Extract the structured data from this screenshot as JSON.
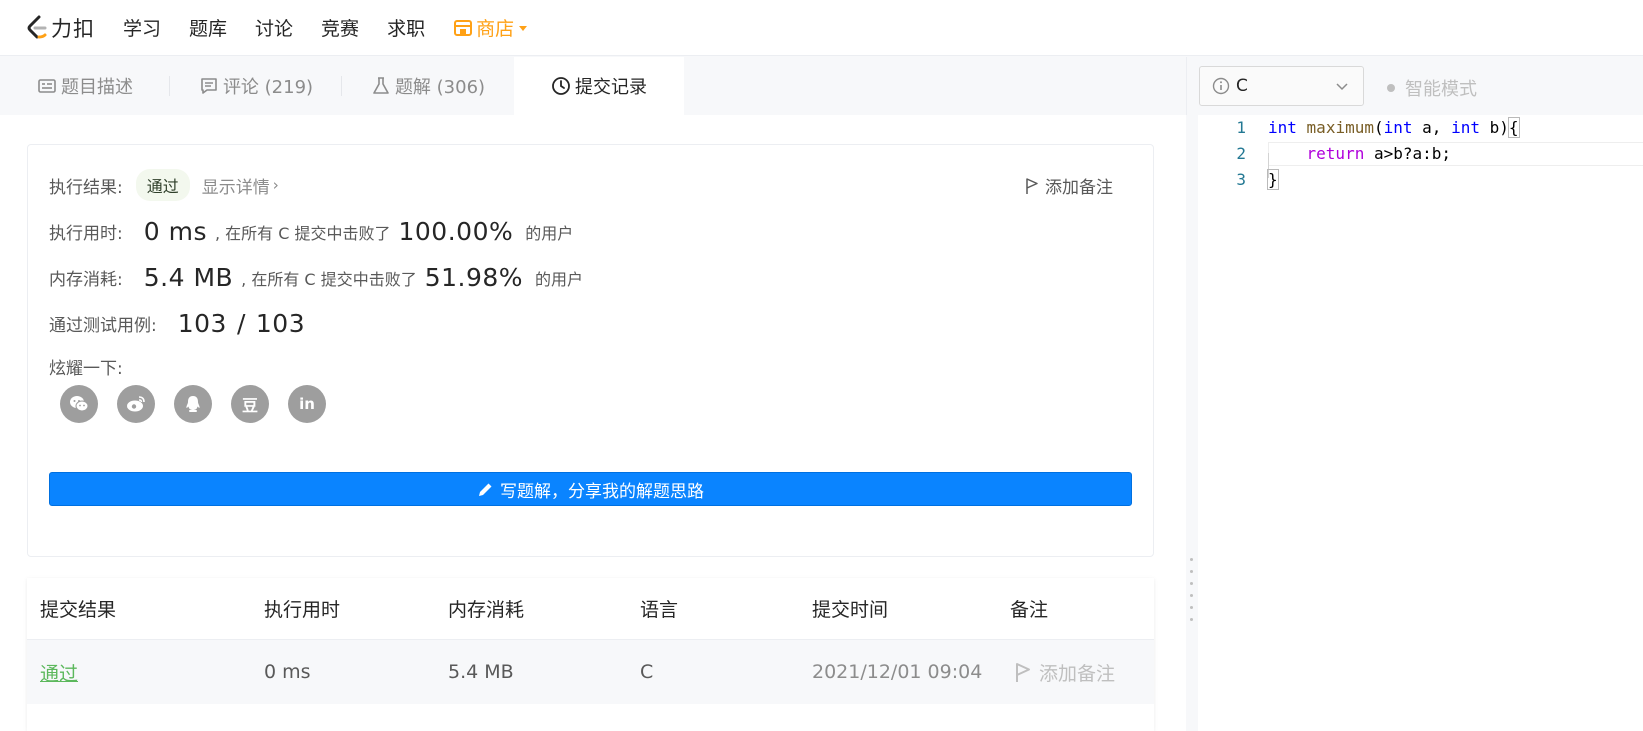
{
  "nav": {
    "logo_text": "力扣",
    "items": [
      "学习",
      "题库",
      "讨论",
      "竞赛",
      "求职"
    ],
    "store_label": "商店",
    "accent": "#ffa116"
  },
  "tabs": [
    {
      "label": "题目描述",
      "icon": "description-icon"
    },
    {
      "label": "评论 (219)",
      "icon": "comment-icon"
    },
    {
      "label": "题解 (306)",
      "icon": "flask-icon"
    },
    {
      "label": "提交记录",
      "icon": "clock-icon",
      "active": true
    }
  ],
  "result": {
    "exec_result_label": "执行结果:",
    "status": "通过",
    "show_details": "显示详情",
    "add_note": "添加备注",
    "time_label": "执行用时:",
    "time_value": "0 ms",
    "beat_text": ", 在所有 C 提交中击败了",
    "time_percent": "100.00%",
    "users_suffix": "的用户",
    "mem_label": "内存消耗:",
    "mem_value": "5.4 MB",
    "mem_percent": "51.98%",
    "cases_label": "通过测试用例:",
    "cases_passed": "103",
    "cases_sep": "/",
    "cases_total": "103",
    "share_label": "炫耀一下:",
    "share_icons": [
      "wechat-icon",
      "weibo-icon",
      "qq-icon",
      "douban-icon",
      "linkedin-icon"
    ],
    "douban_glyph": "豆",
    "linkedin_glyph": "in",
    "write_button": "写题解，分享我的解题思路",
    "button_color": "#0a84ff"
  },
  "table": {
    "headers": [
      "提交结果",
      "执行用时",
      "内存消耗",
      "语言",
      "提交时间",
      "备注"
    ],
    "rows": [
      {
        "status": "通过",
        "time": "0 ms",
        "memory": "5.4 MB",
        "language": "C",
        "submitted": "2021/12/01 09:04",
        "note": "添加备注"
      }
    ],
    "pass_color": "#5cb85c"
  },
  "editor": {
    "language": "C",
    "smart_mode": "智能模式",
    "line_numbers": [
      "1",
      "2",
      "3"
    ],
    "code": {
      "l1_kw1": "int",
      "l1_fn": "maximum",
      "l1_paren": "(",
      "l1_kw2": "int",
      "l1_a": " a, ",
      "l1_kw3": "int",
      "l1_b": " b)",
      "l1_brace": "{",
      "l2_indent": "    ",
      "l2_kw": "return",
      "l2_rest": " a>b?a:b;",
      "l3_brace": "}"
    }
  }
}
